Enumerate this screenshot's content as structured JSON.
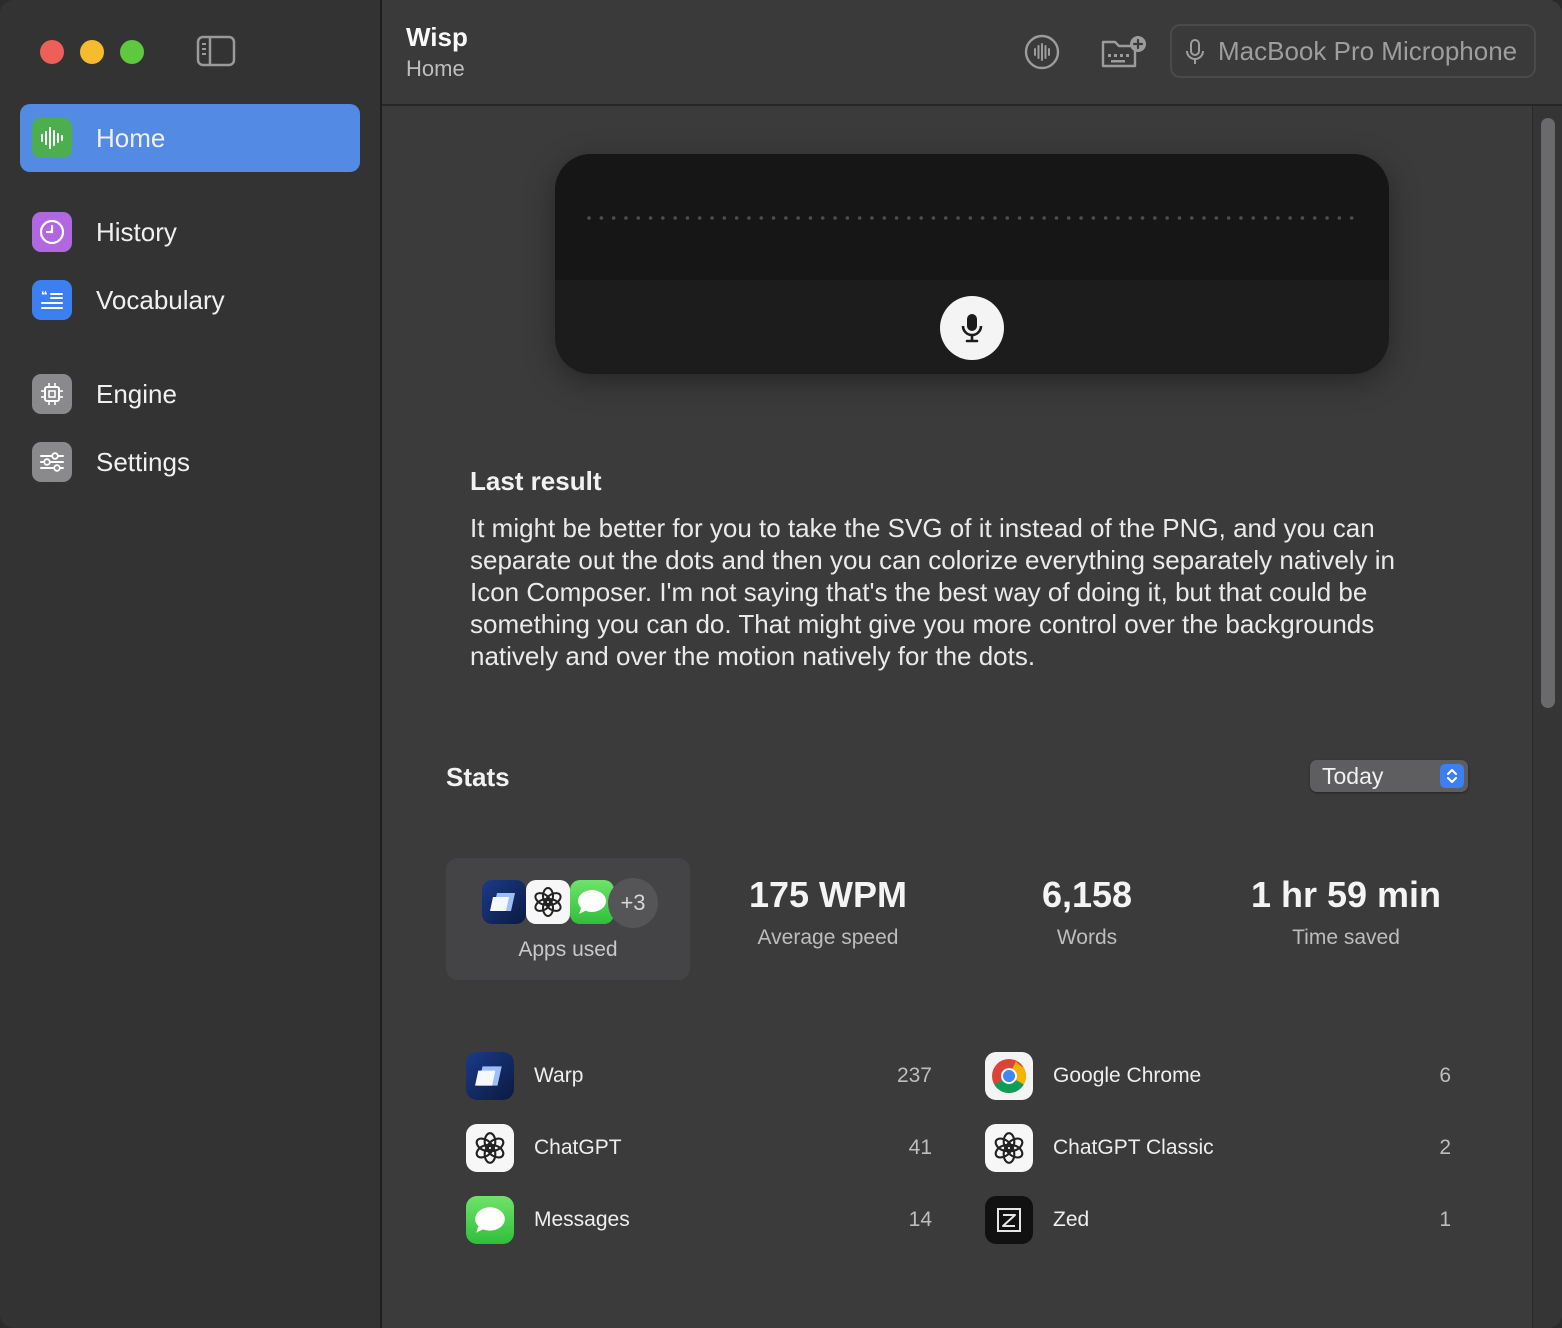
{
  "sidebar": {
    "items": [
      {
        "label": "Home",
        "icon": "waveform-icon",
        "color": "#4cae4f",
        "active": true
      },
      {
        "label": "History",
        "icon": "clock-icon",
        "color": "#b067e0",
        "active": false
      },
      {
        "label": "Vocabulary",
        "icon": "quote-list-icon",
        "color": "#3b7ff0",
        "active": false
      },
      {
        "label": "Engine",
        "icon": "chip-icon",
        "color": "#8a8a8c",
        "active": false
      },
      {
        "label": "Settings",
        "icon": "sliders-icon",
        "color": "#8a8a8c",
        "active": false
      }
    ]
  },
  "header": {
    "title": "Wisp",
    "subtitle": "Home",
    "microphone": "MacBook Pro Microphone"
  },
  "last_result": {
    "heading": "Last result",
    "text": "It might be better for you to take the SVG of it instead of the PNG, and you can separate out the dots and then you can colorize everything separately natively in Icon Composer. I'm not saying that's the best way of doing it, but that could be something you can do. That might give you more control over the backgrounds natively and over the motion natively for the dots."
  },
  "stats": {
    "heading": "Stats",
    "range": "Today",
    "apps_used_label": "Apps used",
    "apps_extra": "+3",
    "summary": [
      {
        "value": "175 WPM",
        "label": "Average speed"
      },
      {
        "value": "6,158",
        "label": "Words"
      },
      {
        "value": "1 hr 59 min",
        "label": "Time saved"
      }
    ],
    "apps": [
      {
        "name": "Warp",
        "count": "237",
        "icon": "warp-icon"
      },
      {
        "name": "Google Chrome",
        "count": "6",
        "icon": "chrome-icon"
      },
      {
        "name": "ChatGPT",
        "count": "41",
        "icon": "chatgpt-icon"
      },
      {
        "name": "ChatGPT Classic",
        "count": "2",
        "icon": "chatgpt-icon"
      },
      {
        "name": "Messages",
        "count": "14",
        "icon": "messages-icon"
      },
      {
        "name": "Zed",
        "count": "1",
        "icon": "zed-icon"
      }
    ]
  },
  "colors": {
    "accent": "#528ae4",
    "sidebar_bg": "#333334",
    "main_bg": "#3b3b3c"
  }
}
